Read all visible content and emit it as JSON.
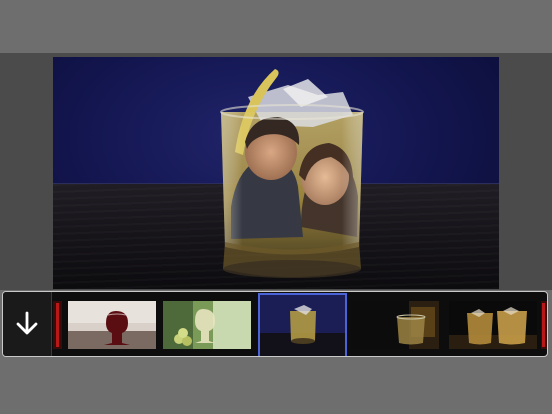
{
  "app": {
    "background_color": "#6e6e6e"
  },
  "editor": {
    "photo_description_icon": "whisky-glass-frame"
  },
  "strip": {
    "download_icon": "arrow-down-icon",
    "selected_index": 3,
    "accent_color": "#4a63d6",
    "thumbnails": [
      {
        "id": "film-edge-left"
      },
      {
        "id": "red-wine-glass"
      },
      {
        "id": "white-wine-glass-grapes"
      },
      {
        "id": "whisky-glass-blue"
      },
      {
        "id": "whisky-glass-dark"
      },
      {
        "id": "two-whisky-glasses"
      },
      {
        "id": "film-edge-right"
      }
    ]
  }
}
